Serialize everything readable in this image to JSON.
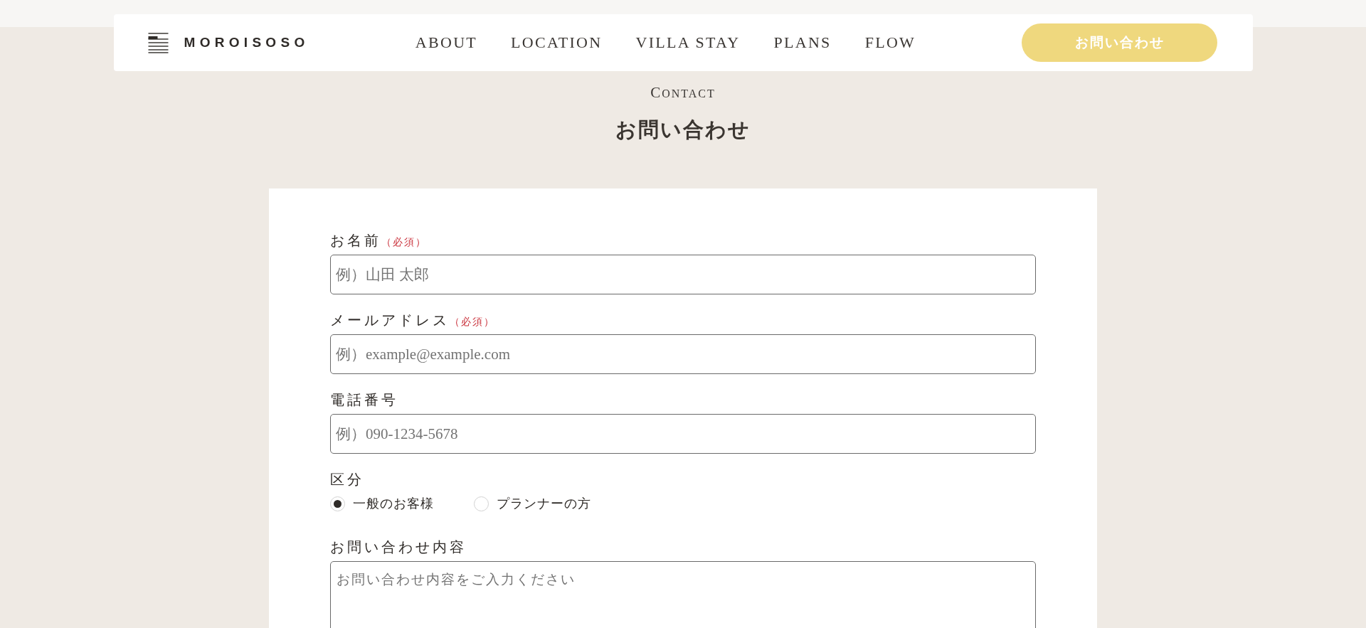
{
  "header": {
    "logo": "MOROISOSO",
    "nav": [
      {
        "label": "ABOUT"
      },
      {
        "label": "LOCATION"
      },
      {
        "label": "VILLA STAY"
      },
      {
        "label": "PLANS"
      },
      {
        "label": "FLOW"
      }
    ],
    "cta": "お問い合わせ"
  },
  "page_title": {
    "eyebrow": "CONTACT",
    "heading": "お問い合わせ"
  },
  "form": {
    "fields": [
      {
        "kind": "text",
        "label": "お名前",
        "required_note": "（必須）",
        "placeholder": "例）山田 太郎"
      },
      {
        "kind": "text",
        "label": "メールアドレス",
        "required_note": "（必須）",
        "placeholder": "例）example@example.com"
      },
      {
        "kind": "text",
        "label": "電話番号",
        "placeholder": "例）090-1234-5678"
      },
      {
        "kind": "radio",
        "label": "区分",
        "options": [
          {
            "label": "一般のお客様",
            "selected": true
          },
          {
            "label": "プランナーの方",
            "selected": false
          }
        ]
      },
      {
        "kind": "textarea",
        "label": "お問い合わせ内容",
        "placeholder": "お問い合わせ内容をご入力ください"
      }
    ]
  }
}
